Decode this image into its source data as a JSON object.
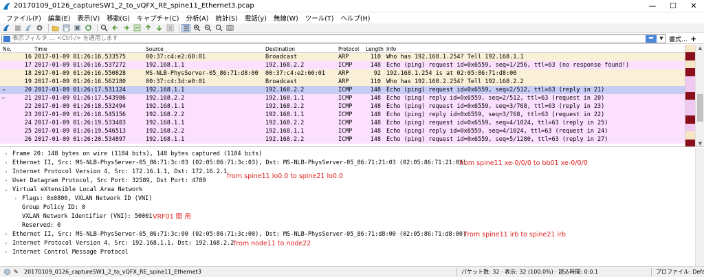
{
  "window": {
    "title": "20170109_0126_captureSW1_2_to_vQFX_RE_spine11_Ethernet3.pcap",
    "minimize": "—",
    "maximize": "☐",
    "close": "✕"
  },
  "menu": [
    "ファイル(F)",
    "編集(E)",
    "表示(V)",
    "移動(G)",
    "キャプチャ(C)",
    "分析(A)",
    "統計(S)",
    "電話(y)",
    "無線(W)",
    "ツール(T)",
    "ヘルプ(H)"
  ],
  "toolbar": {
    "icons": [
      "shark-fin-start-icon",
      "stop-icon",
      "restart-icon",
      "options-gear-icon",
      "open-file-icon",
      "save-icon",
      "close-file-icon",
      "reload-icon",
      "find-icon",
      "back-icon",
      "forward-icon",
      "goto-icon",
      "first-icon",
      "last-icon",
      "autoscroll-icon",
      "colorize-icon",
      "zoom-in-icon",
      "zoom-out-icon",
      "zoom-normal-icon",
      "resize-columns-icon"
    ]
  },
  "filter": {
    "placeholder": "表示フィルタ … <Ctrl-/> を適用します",
    "expression_label": "書式…",
    "add_label": "+"
  },
  "columns": {
    "no": "No.",
    "time": "Time",
    "source": "Source",
    "destination": "Destination",
    "protocol": "Protocol",
    "length": "Length",
    "info": "Info"
  },
  "packets": [
    {
      "no": "16",
      "time": "2017-01-09 01:26:16.533575",
      "source": "00:37:c4:e2:60:01",
      "destination": "Broadcast",
      "protocol": "ARP",
      "length": "110",
      "info": "Who has 192.168.1.254? Tell 192.168.1.1",
      "bg": "#faf0d7",
      "mark": ""
    },
    {
      "no": "17",
      "time": "2017-01-09 01:26:16.537272",
      "source": "192.168.1.1",
      "destination": "192.168.2.2",
      "protocol": "ICMP",
      "length": "148",
      "info": "Echo (ping) request  id=0x6559, seq=1/256, ttl=63 (no response found!)",
      "bg": "#fce0ff",
      "mark": ""
    },
    {
      "no": "18",
      "time": "2017-01-09 01:26:16.550828",
      "source": "MS-NLB-PhysServer-05_86:71:d8:00",
      "destination": "00:37:c4:e2:60:01",
      "protocol": "ARP",
      "length": "92",
      "info": "192.168.1.254 is at 02:05:86:71:d8:00",
      "bg": "#faf0d7",
      "mark": ""
    },
    {
      "no": "19",
      "time": "2017-01-09 01:26:16.562180",
      "source": "00:37:c4:3d:e0:01",
      "destination": "Broadcast",
      "protocol": "ARP",
      "length": "110",
      "info": "Who has 192.168.2.254? Tell 192.168.2.2",
      "bg": "#faf0d7",
      "mark": ""
    },
    {
      "no": "20",
      "time": "2017-01-09 01:26:17.531124",
      "source": "192.168.1.1",
      "destination": "192.168.2.2",
      "protocol": "ICMP",
      "length": "148",
      "info": "Echo (ping) request  id=0x6559, seq=2/512, ttl=63 (reply in 21)",
      "bg": "#c7cdf5",
      "mark": "→"
    },
    {
      "no": "21",
      "time": "2017-01-09 01:26:17.543986",
      "source": "192.168.2.2",
      "destination": "192.168.1.1",
      "protocol": "ICMP",
      "length": "148",
      "info": "Echo (ping) reply    id=0x6559, seq=2/512, ttl=63 (request in 20)",
      "bg": "#fce0ff",
      "mark": "←"
    },
    {
      "no": "22",
      "time": "2017-01-09 01:26:18.532494",
      "source": "192.168.1.1",
      "destination": "192.168.2.2",
      "protocol": "ICMP",
      "length": "148",
      "info": "Echo (ping) request  id=0x6559, seq=3/768, ttl=63 (reply in 23)",
      "bg": "#fce0ff",
      "mark": ""
    },
    {
      "no": "23",
      "time": "2017-01-09 01:26:18.545156",
      "source": "192.168.2.2",
      "destination": "192.168.1.1",
      "protocol": "ICMP",
      "length": "148",
      "info": "Echo (ping) reply    id=0x6559, seq=3/768, ttl=63 (request in 22)",
      "bg": "#fce0ff",
      "mark": ""
    },
    {
      "no": "24",
      "time": "2017-01-09 01:26:19.533403",
      "source": "192.168.1.1",
      "destination": "192.168.2.2",
      "protocol": "ICMP",
      "length": "148",
      "info": "Echo (ping) request  id=0x6559, seq=4/1024, ttl=63 (reply in 25)",
      "bg": "#fce0ff",
      "mark": ""
    },
    {
      "no": "25",
      "time": "2017-01-09 01:26:19.546513",
      "source": "192.168.2.2",
      "destination": "192.168.1.1",
      "protocol": "ICMP",
      "length": "148",
      "info": "Echo (ping) reply    id=0x6559, seq=4/1024, ttl=63 (request in 24)",
      "bg": "#fce0ff",
      "mark": ""
    },
    {
      "no": "26",
      "time": "2017-01-09 01:26:20.534897",
      "source": "192.168.1.1",
      "destination": "192.168.2.2",
      "protocol": "ICMP",
      "length": "148",
      "info": "Echo (ping) request  id=0x6559, seq=5/1280, ttl=63 (reply in 27)",
      "bg": "#fce0ff",
      "mark": ""
    }
  ],
  "minimap_colors": [
    "#f5e6c6",
    "#8a0f1b",
    "#f5e6c6",
    "#8a0f1b",
    "#f0c8f0",
    "#f0c8f0",
    "#8a0f1b",
    "#f0c8f0",
    "#f0c8f0",
    "#8a0f1b",
    "#f0c8f0",
    "#f5e6c6",
    "#8a0f1b"
  ],
  "details": [
    {
      "indent": 0,
      "toggle": "›",
      "text": "Frame 20: 148 bytes on wire (1184 bits), 148 bytes captured (1184 bits)"
    },
    {
      "indent": 0,
      "toggle": "›",
      "text": "Ethernet II, Src: MS-NLB-PhysServer-05_86:71:3c:03 (02:05:86:71:3c:03), Dst: MS-NLB-PhysServer-05_86:71:21:03 (02:05:86:71:21:03)",
      "annot": "from spine11 xe-0/0/0 to bb01 xe-0/0/0"
    },
    {
      "indent": 0,
      "toggle": "›",
      "text": "Internet Protocol Version 4, Src: 172.16.1.1, Dst: 172.16.2.1"
    },
    {
      "indent": 0,
      "toggle": "›",
      "text": "User Datagram Protocol, Src Port: 32589, Dst Port: 4789"
    },
    {
      "indent": 0,
      "toggle": "⌄",
      "text": "Virtual eXtensible Local Area Network"
    },
    {
      "indent": 1,
      "toggle": "›",
      "text": "Flags: 0x0800, VXLAN Network ID (VNI)"
    },
    {
      "indent": 1,
      "toggle": "",
      "text": "Group Policy ID: 0"
    },
    {
      "indent": 1,
      "toggle": "",
      "text": "VXLAN Network Identifier (VNI): 50001",
      "annot": "VRF01 間 用"
    },
    {
      "indent": 1,
      "toggle": "",
      "text": "Reserved: 0"
    },
    {
      "indent": 0,
      "toggle": "›",
      "text": "Ethernet II, Src: MS-NLB-PhysServer-05_86:71:3c:00 (02:05:86:71:3c:00), Dst: MS-NLB-PhysServer-05_86:71:d8:00 (02:05:86:71:d8:00)",
      "annot": "from spine11 irb to spine21 irb"
    },
    {
      "indent": 0,
      "toggle": "›",
      "text": "Internet Protocol Version 4, Src: 192.168.1.1, Dst: 192.168.2.2",
      "annot": "from node11 to node22"
    },
    {
      "indent": 0,
      "toggle": "›",
      "text": "Internet Control Message Protocol"
    }
  ],
  "ipv4_annot": "from spine11 lo0.0 to spine21 lo0.0",
  "status": {
    "file": "20170109_0126_captureSW1_2_to_vQFX_RE_spine11_Ethernet3",
    "stats": "パケット数: 32 · 表示: 32 (100.0%) · 読込時間: 0:0.1",
    "profile": "プロファイル: Default"
  },
  "colors": {
    "annotation": "#e02020",
    "selected_row": "#c7cdf5",
    "icmp_row": "#fce0ff",
    "arp_row": "#faf0d7"
  }
}
